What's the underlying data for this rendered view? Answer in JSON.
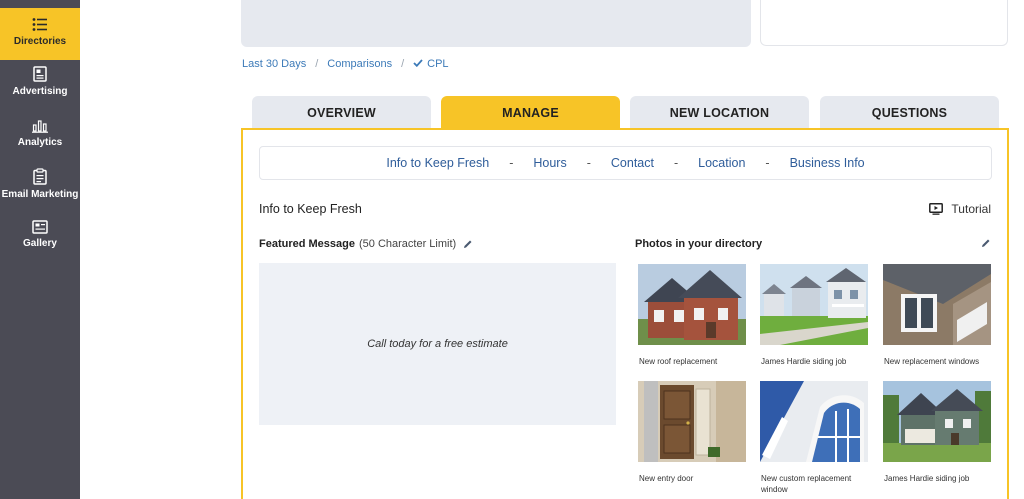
{
  "sidebar": {
    "items": [
      {
        "label": "Directories",
        "icon": "list-icon",
        "active": true
      },
      {
        "label": "Advertising",
        "icon": "newspaper-icon",
        "active": false
      },
      {
        "label": "Analytics",
        "icon": "bar-chart-icon",
        "active": false
      },
      {
        "label": "Email Marketing",
        "icon": "clipboard-icon",
        "active": false
      },
      {
        "label": "Gallery",
        "icon": "image-frame-icon",
        "active": false
      }
    ]
  },
  "breadcrumb": {
    "items": [
      "Last 30 Days",
      "Comparisons",
      "CPL"
    ],
    "checked_icon": "checkmark-icon"
  },
  "tabs": [
    {
      "label": "OVERVIEW",
      "active": false
    },
    {
      "label": "MANAGE",
      "active": true
    },
    {
      "label": "NEW LOCATION",
      "active": false
    },
    {
      "label": "QUESTIONS",
      "active": false
    }
  ],
  "subnav": {
    "items": [
      "Info to Keep Fresh",
      "Hours",
      "Contact",
      "Location",
      "Business Info"
    ],
    "separator": "-"
  },
  "section": {
    "title": "Info to Keep Fresh",
    "tutorial_label": "Tutorial",
    "tutorial_icon": "play-screen-icon"
  },
  "featured_message": {
    "label": "Featured Message",
    "limit": "(50 Character Limit)",
    "value": "Call today for a free estimate",
    "edit_icon": "pencil-icon"
  },
  "photos": {
    "label": "Photos in your directory",
    "edit_icon": "pencil-icon",
    "items": [
      {
        "caption": "New roof replacement"
      },
      {
        "caption": "James Hardie siding job"
      },
      {
        "caption": "New replacement windows"
      },
      {
        "caption": "New entry door"
      },
      {
        "caption": "New custom replacement window"
      },
      {
        "caption": "James Hardie siding job"
      }
    ]
  },
  "colors": {
    "sidebar_bg": "#4b4b55",
    "accent": "#f7c427",
    "link": "#3c7ab8",
    "subnav_text": "#2f5d9a",
    "tab_bg": "#e6e9ef"
  }
}
